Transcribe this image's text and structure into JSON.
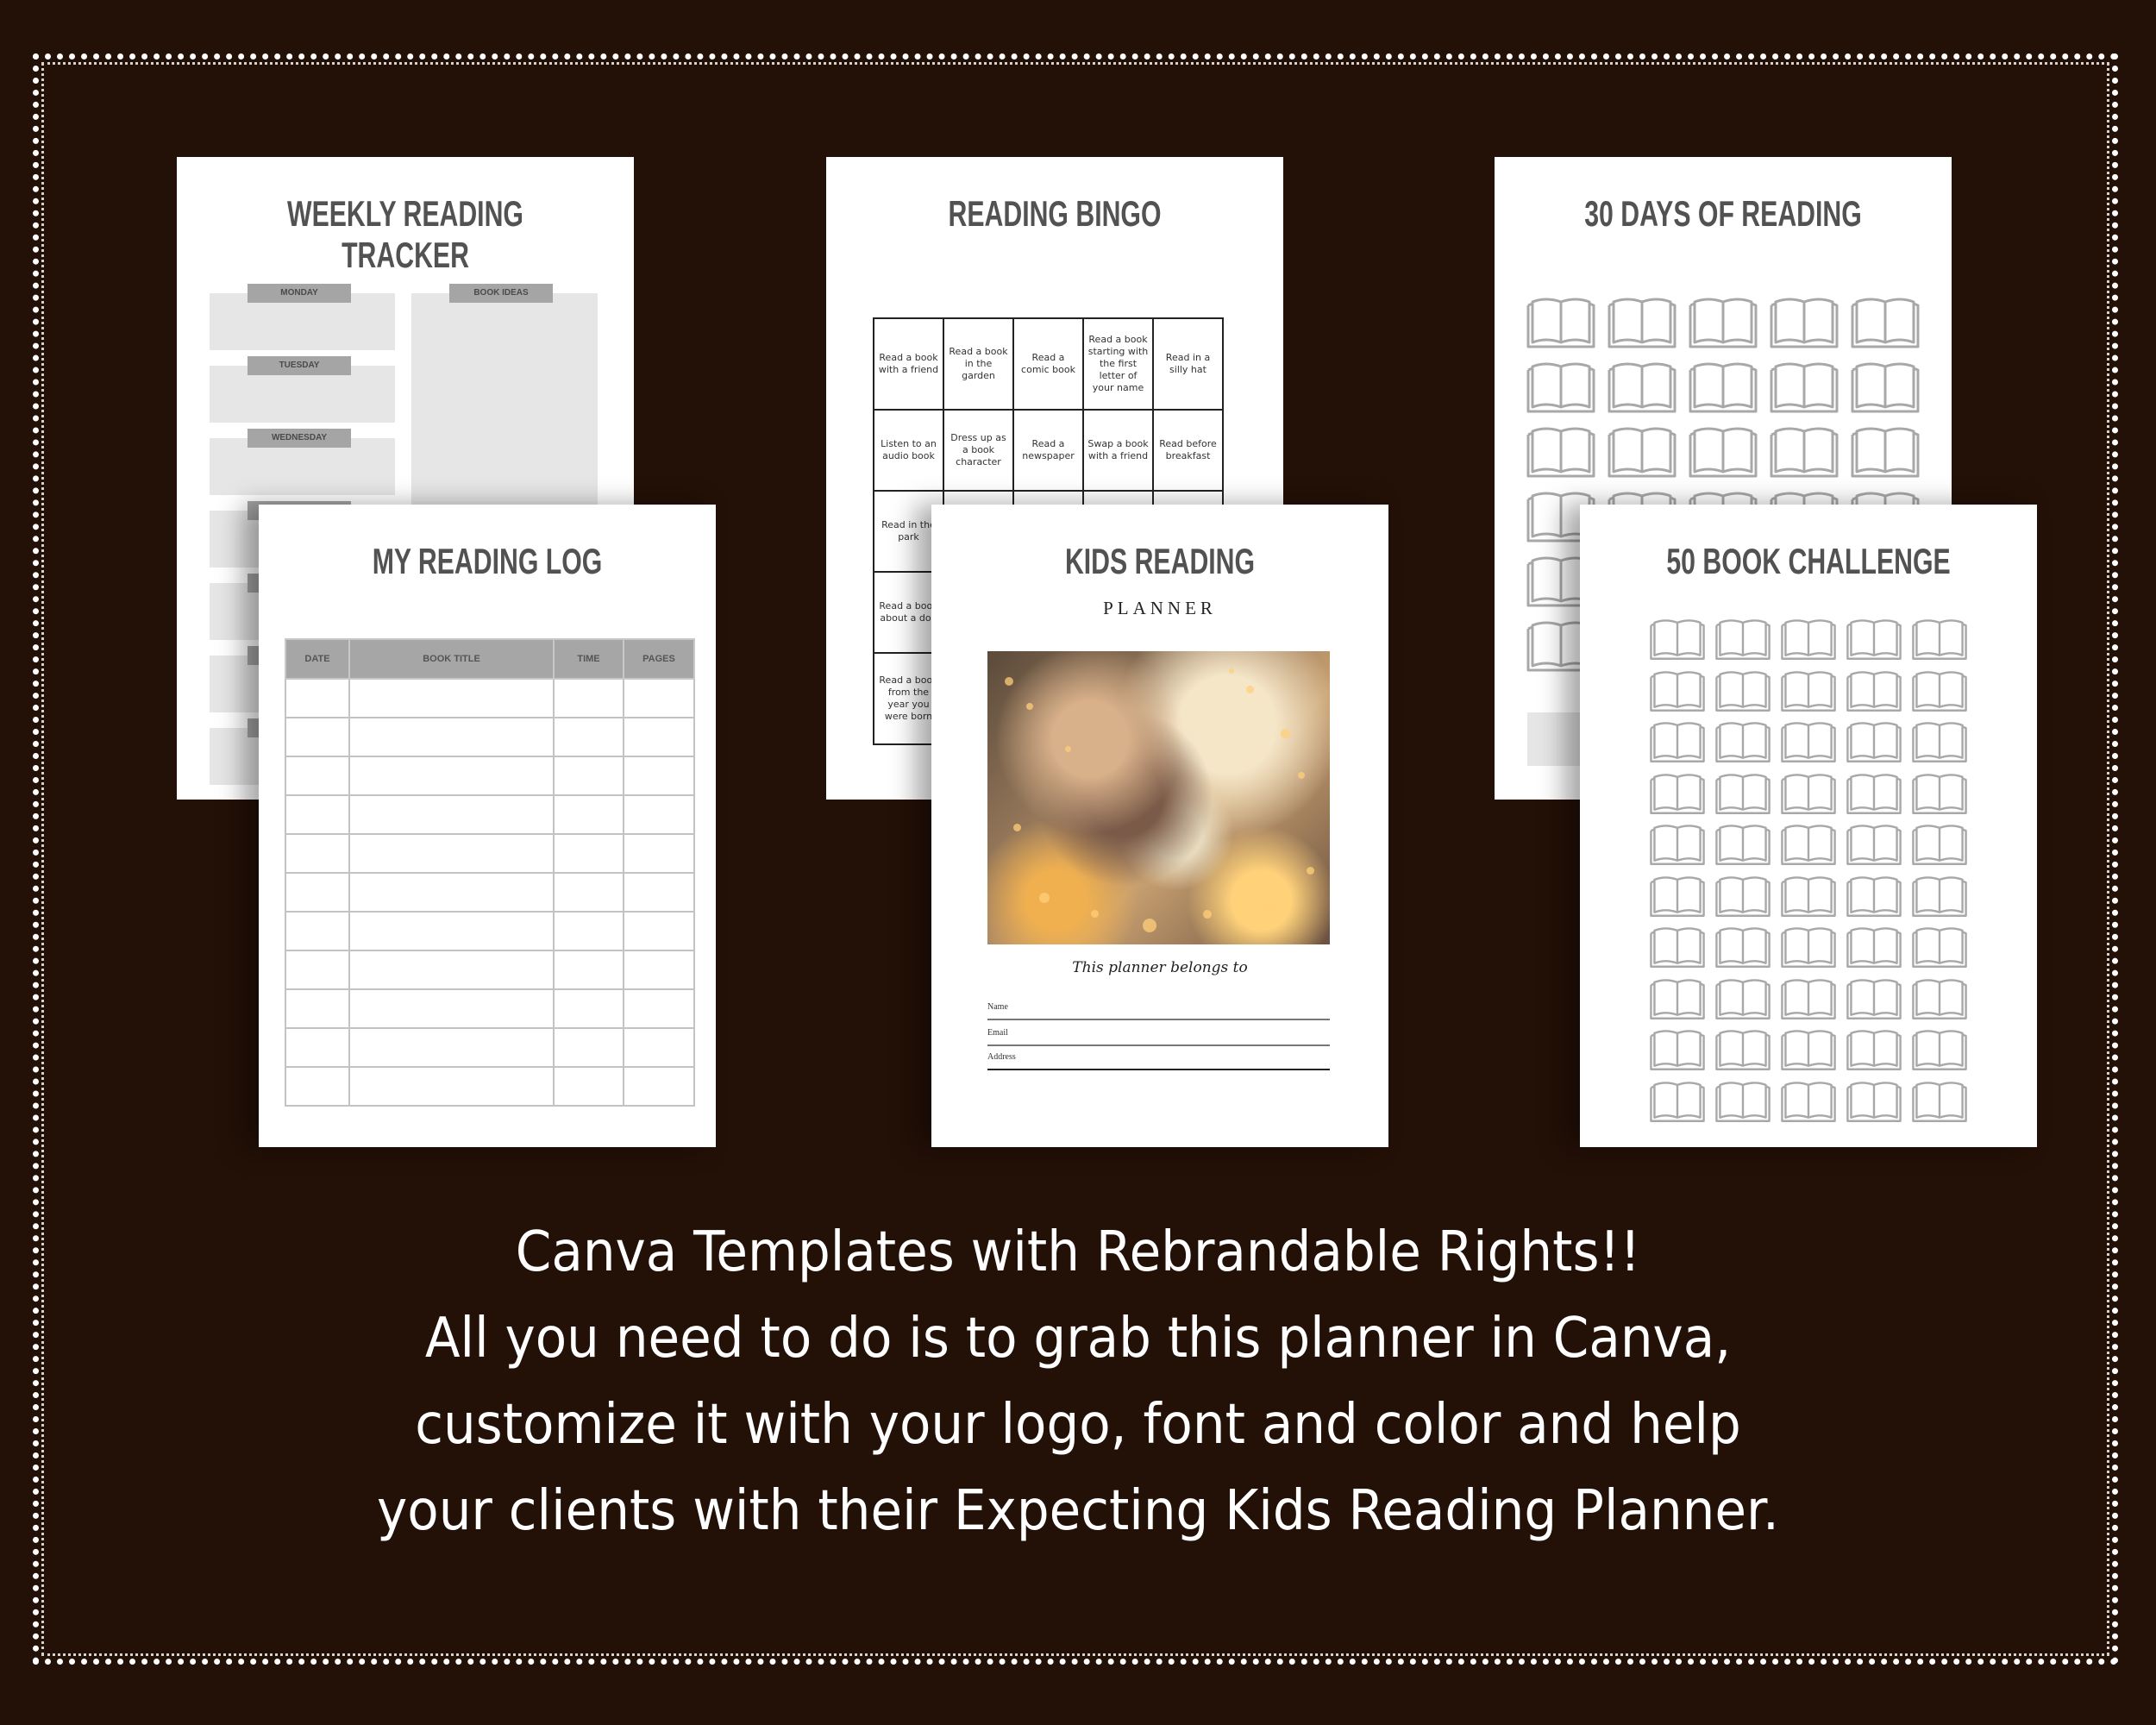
{
  "colors": {
    "background": "#231007",
    "page": "#ffffff",
    "title_gray": "#525252",
    "box_gray": "#e6e6e6",
    "tab_gray": "#a5a5a5",
    "icon_gray": "#a8a8a8",
    "caption_text": "#ffffff"
  },
  "pages": {
    "weekly_tracker": {
      "title": "WEEKLY READING TRACKER",
      "days": [
        "MONDAY",
        "TUESDAY",
        "WEDNESDAY"
      ],
      "book_ideas_label": "BOOK IDEAS"
    },
    "bingo": {
      "title": "READING BINGO",
      "cells": [
        [
          "Read a book with a friend",
          "Read a book in the garden",
          "Read a comic book",
          "Read a book starting with the first letter of your name",
          "Read in a silly hat"
        ],
        [
          "Listen to an audio book",
          "Dress up as a book character",
          "Read a newspaper",
          "Swap a book with a friend",
          "Read before breakfast"
        ],
        [
          "Read in the park",
          "",
          "",
          "",
          ""
        ],
        [
          "Read a book about a dog",
          "",
          "",
          "",
          ""
        ],
        [
          "Read a book from the year you were born",
          "",
          "",
          "",
          ""
        ]
      ]
    },
    "thirty_days": {
      "title": "30 DAYS OF READING",
      "icon": "open-book-icon",
      "count": 30
    },
    "reading_log": {
      "title": "MY READING LOG",
      "columns": [
        "DATE",
        "BOOK TITLE",
        "TIME",
        "PAGES"
      ],
      "rows": 11
    },
    "kids_cover": {
      "title": "KIDS READING",
      "subtitle": "PLANNER",
      "belongs": "This planner belongs to",
      "fields": [
        "Name",
        "Email",
        "Address"
      ]
    },
    "fifty_books": {
      "title": "50 BOOK CHALLENGE",
      "icon": "open-book-icon",
      "count": 50
    }
  },
  "caption": {
    "lines": [
      "Canva Templates with Rebrandable Rights!!",
      "All you need to do is to grab this planner in Canva,",
      "customize it with your logo, font and color and help",
      "your clients with their Expecting Kids Reading Planner."
    ]
  }
}
